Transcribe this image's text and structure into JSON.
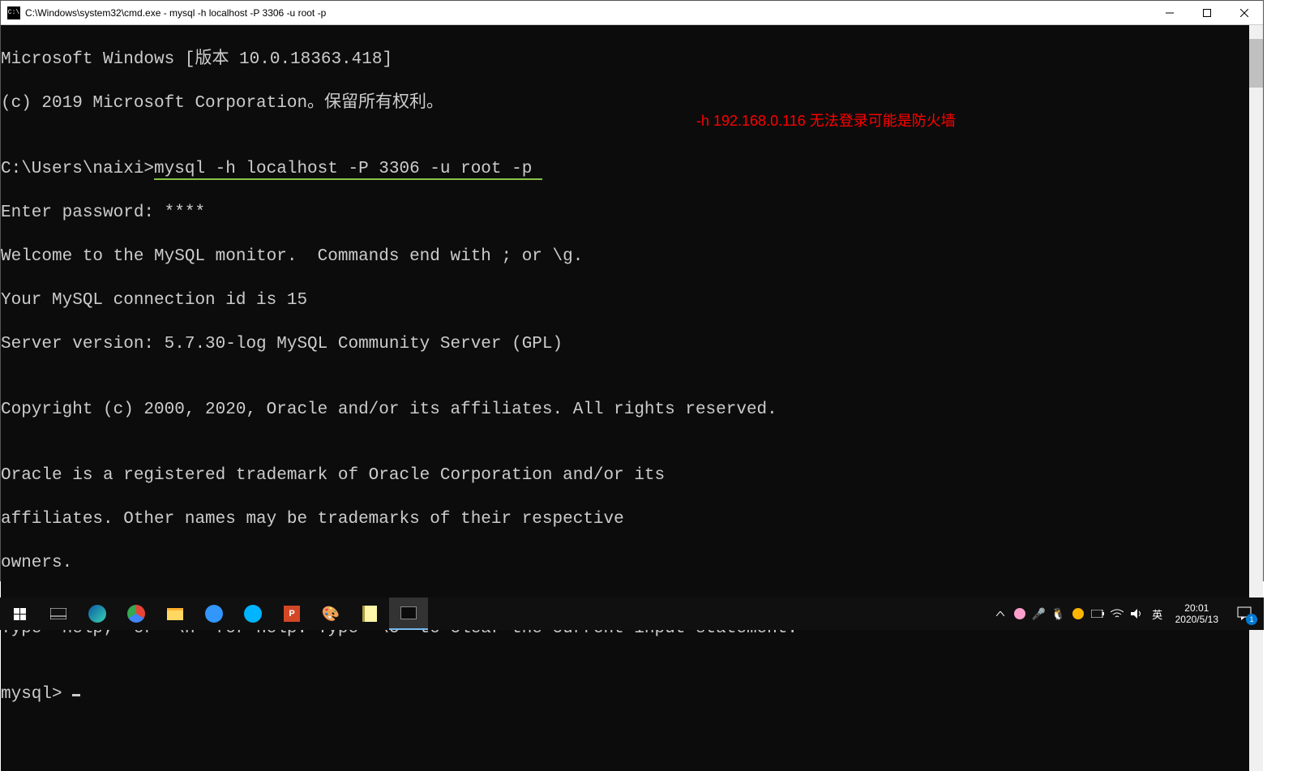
{
  "window": {
    "icon_text": "C:\\",
    "title": "C:\\Windows\\system32\\cmd.exe - mysql  -h localhost -P 3306 -u root -p"
  },
  "terminal": {
    "l1": "Microsoft Windows [版本 10.0.18363.418]",
    "l2": "(c) 2019 Microsoft Corporation。保留所有权利。",
    "l3": "",
    "l4_prompt": "C:\\Users\\naixi>",
    "l4_cmd": "mysql -h localhost -P 3306 -u root -p ",
    "l5": "Enter password: ****",
    "l6": "Welcome to the MySQL monitor.  Commands end with ; or \\g.",
    "l7": "Your MySQL connection id is 15",
    "l8": "Server version: 5.7.30-log MySQL Community Server (GPL)",
    "l9": "",
    "l10": "Copyright (c) 2000, 2020, Oracle and/or its affiliates. All rights reserved.",
    "l11": "",
    "l12": "Oracle is a registered trademark of Oracle Corporation and/or its",
    "l13": "affiliates. Other names may be trademarks of their respective",
    "l14": "owners.",
    "l15": "",
    "l16": "Type 'help;' or '\\h' for help. Type '\\c' to clear the current input statement.",
    "l17": "",
    "l18": "mysql> "
  },
  "annotation": "-h 192.168.0.116 无法登录可能是防火墙",
  "taskbar": {
    "clock_time": "20:01",
    "clock_date": "2020/5/13",
    "ime": "英",
    "notif_count": "1"
  }
}
